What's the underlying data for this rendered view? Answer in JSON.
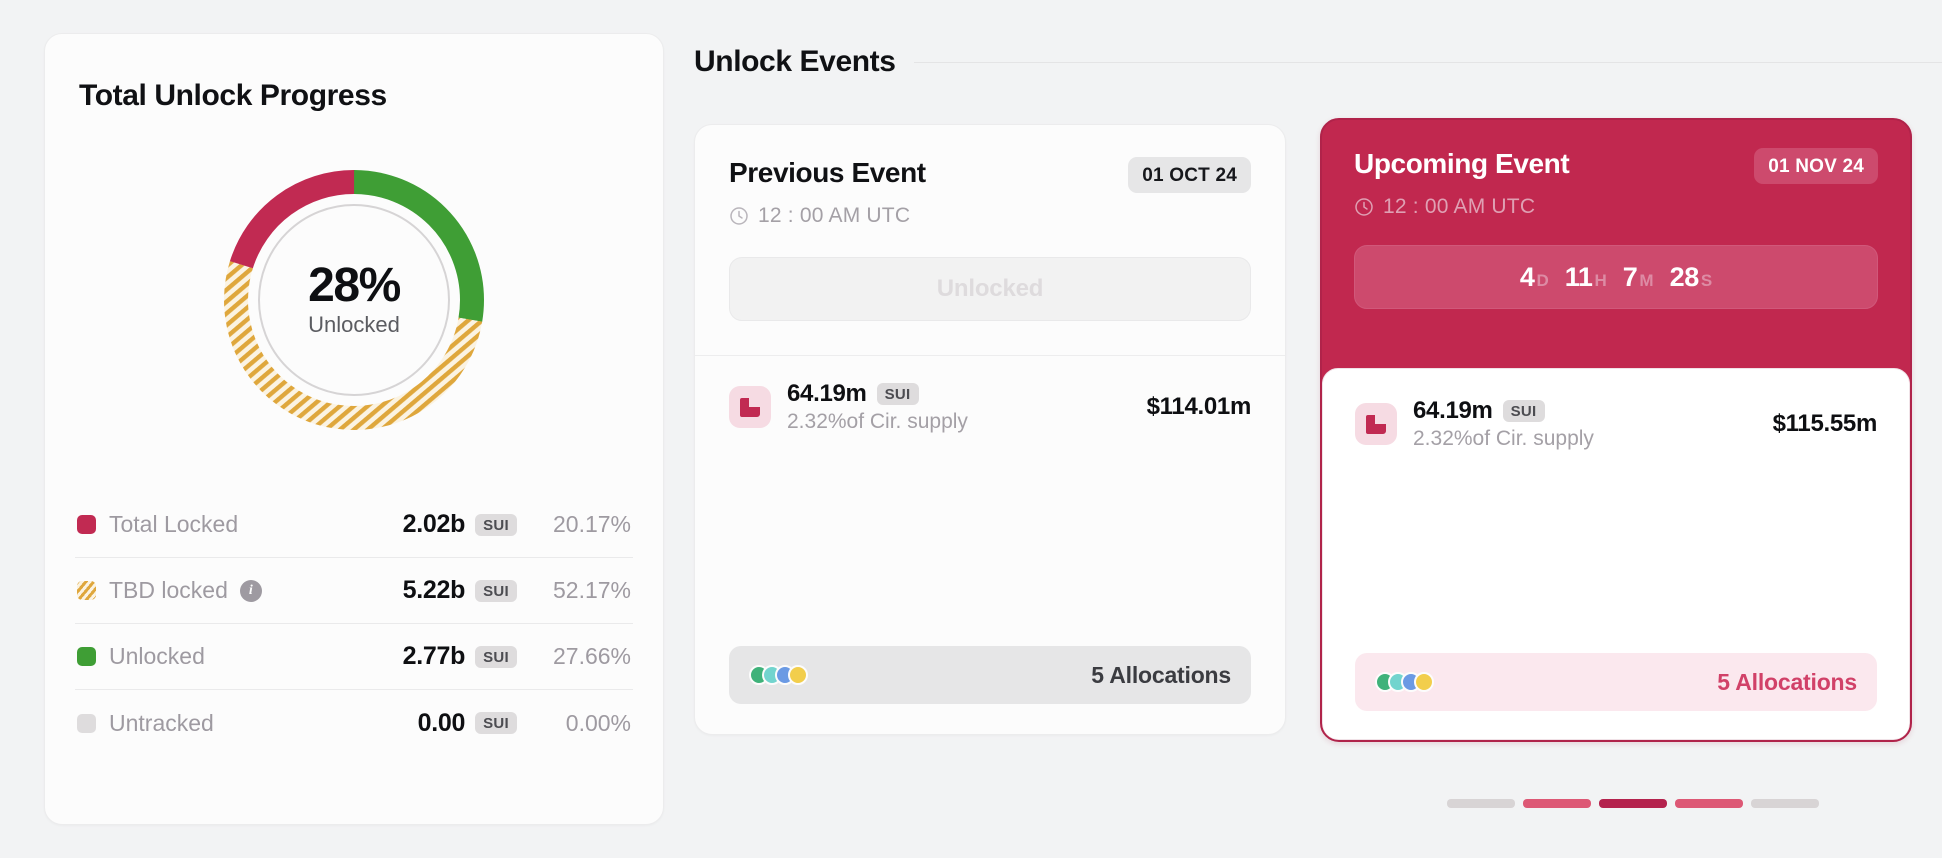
{
  "progress": {
    "title": "Total Unlock Progress",
    "donut": {
      "percent_label": "28%",
      "sub_label": "Unlocked"
    },
    "legend": [
      {
        "name": "Total Locked",
        "swatch": "solid",
        "color": "#c12a52",
        "value": "2.02b",
        "unit": "SUI",
        "percent": "20.17%",
        "has_info": false
      },
      {
        "name": "TBD locked",
        "swatch": "striped",
        "color": "#dfa73c",
        "value": "5.22b",
        "unit": "SUI",
        "percent": "52.17%",
        "has_info": true,
        "info_glyph": "i"
      },
      {
        "name": "Unlocked",
        "swatch": "solid",
        "color": "#3f9e35",
        "value": "2.77b",
        "unit": "SUI",
        "percent": "27.66%",
        "has_info": false
      },
      {
        "name": "Untracked",
        "swatch": "solid",
        "color": "#dedcdd",
        "value": "0.00",
        "unit": "SUI",
        "percent": "0.00%",
        "has_info": false
      }
    ]
  },
  "events": {
    "header_title": "Unlock Events",
    "previous": {
      "title": "Previous Event",
      "date_badge": "01 OCT 24",
      "time": "12 : 00 AM UTC",
      "status_button": "Unlocked",
      "allocation": {
        "amount": "64.19m",
        "unit": "SUI",
        "supply_note": "2.32%of Cir. supply",
        "usd_value": "$114.01m"
      },
      "footer": {
        "count_label": "5 Allocations",
        "dot_colors": [
          "#3fb27a",
          "#72d4ce",
          "#6b9ae4",
          "#f2ce4c"
        ]
      }
    },
    "upcoming": {
      "title": "Upcoming Event",
      "date_badge": "01 NOV 24",
      "time": "12 : 00 AM UTC",
      "countdown": [
        {
          "num": "4",
          "unit": "D"
        },
        {
          "num": "11",
          "unit": "H"
        },
        {
          "num": "7",
          "unit": "M"
        },
        {
          "num": "28",
          "unit": "S"
        }
      ],
      "allocation": {
        "amount": "64.19m",
        "unit": "SUI",
        "supply_note": "2.32%of Cir. supply",
        "usd_value": "$115.55m"
      },
      "footer": {
        "count_label": "5 Allocations",
        "dot_colors": [
          "#3fb27a",
          "#72d4ce",
          "#6b9ae4",
          "#f2ce4c"
        ]
      }
    },
    "pagination": [
      {
        "color": "#d8d4d5",
        "active": false
      },
      {
        "color": "#dd5875",
        "active": false
      },
      {
        "color": "#b4224d",
        "active": true
      },
      {
        "color": "#dd5875",
        "active": false
      },
      {
        "color": "#d8d4d5",
        "active": false
      }
    ]
  },
  "chart_data": {
    "type": "pie",
    "title": "Total Unlock Progress",
    "center_value": "28%",
    "center_label": "Unlocked",
    "categories": [
      "Unlocked",
      "TBD locked",
      "Total Locked",
      "Untracked"
    ],
    "values": [
      27.66,
      52.17,
      20.17,
      0.0
    ],
    "value_unit": "percent",
    "token_amounts": [
      "2.77b",
      "5.22b",
      "2.02b",
      "0.00"
    ],
    "token_symbol": "SUI",
    "colors": [
      "#3f9e35",
      "#dfa73c",
      "#c12a52",
      "#dedcdd"
    ],
    "patterns": [
      "solid",
      "diagonal-stripes",
      "solid",
      "solid"
    ],
    "start_angle_deg": 0,
    "direction": "clockwise",
    "legend_position": "below",
    "grid": false
  }
}
